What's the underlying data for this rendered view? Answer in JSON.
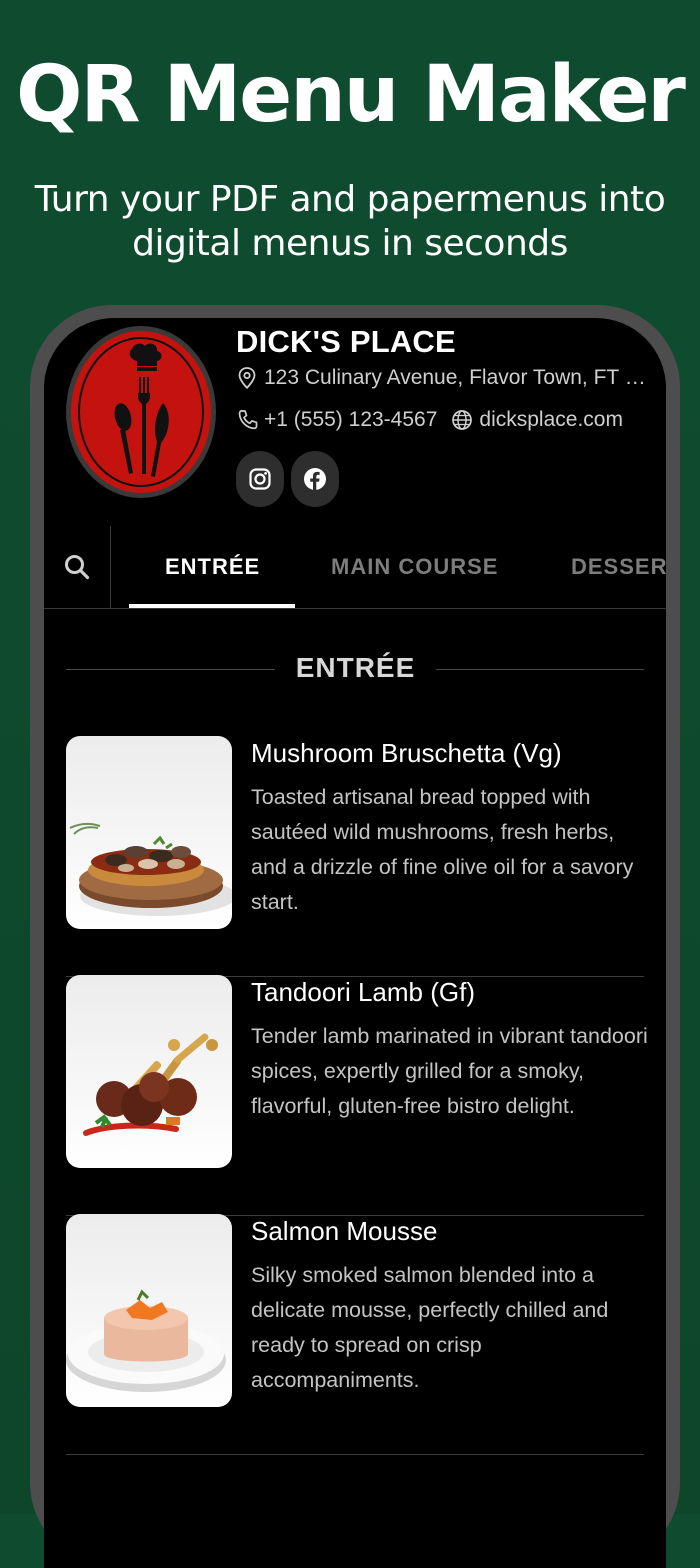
{
  "promo": {
    "title": "QR Menu Maker",
    "subtitle": "Turn your PDF and papermenus into digital menus in seconds"
  },
  "restaurant": {
    "name": "DICK'S PLACE",
    "address": "123 Culinary Avenue, Flavor Town, FT 9...",
    "phone": "+1 (555) 123-4567",
    "website": "dicksplace.com",
    "social": [
      "instagram-icon",
      "facebook-icon"
    ],
    "logo_color": "#c4130f"
  },
  "tabs": [
    {
      "label": "ENTRÉE",
      "active": true
    },
    {
      "label": "MAIN COURSE",
      "active": false
    },
    {
      "label": "DESSERT",
      "active": false
    }
  ],
  "section": {
    "title": "ENTRÉE"
  },
  "items": [
    {
      "name": "Mushroom Bruschetta (Vg)",
      "description": "Toasted artisanal bread topped with sautéed wild mushrooms, fresh herbs, and a drizzle of fine olive oil for a savory start."
    },
    {
      "name": "Tandoori Lamb (Gf)",
      "description": "Tender lamb marinated in vibrant tandoori spices, expertly grilled for a smoky, flavorful, gluten-free bistro delight."
    },
    {
      "name": "Salmon Mousse",
      "description": "Silky smoked salmon blended into a delicate mousse, perfectly chilled and ready to spread on crisp accompaniments."
    }
  ],
  "colors": {
    "background": "#0f4a2e",
    "screen": "#000000",
    "frame": "#4d4d4d"
  }
}
